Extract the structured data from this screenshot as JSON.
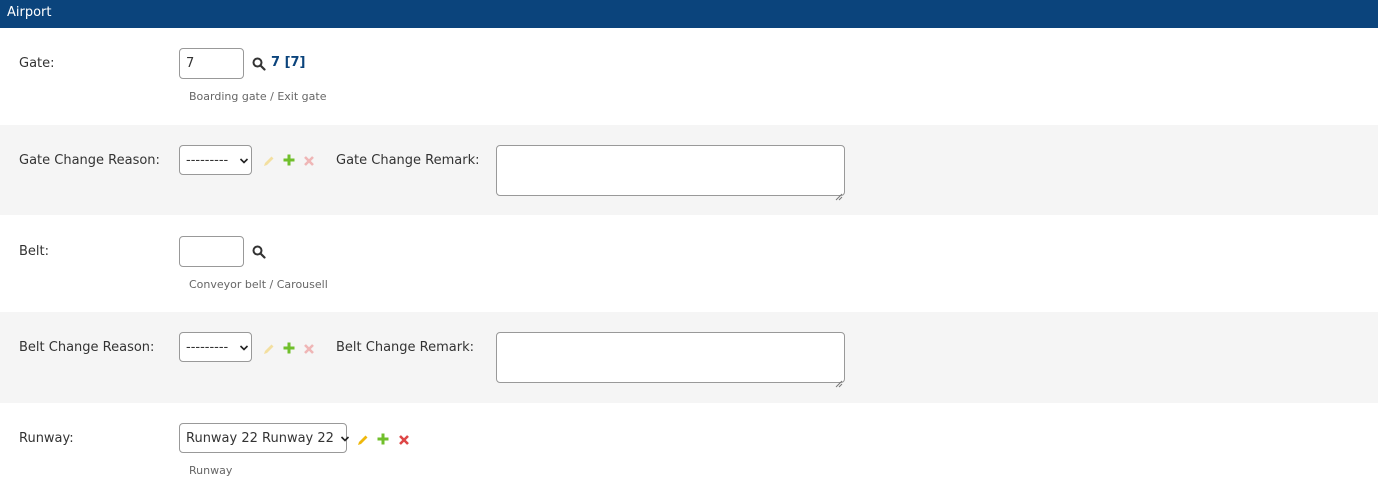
{
  "fieldset": {
    "title": "Airport"
  },
  "gate": {
    "label": "Gate:",
    "value": "7",
    "lookup_text": "7 [7]",
    "help": "Boarding gate / Exit gate",
    "icon": "search-icon"
  },
  "gate_change": {
    "reason_label": "Gate Change Reason:",
    "reason_value": "---------",
    "remark_label": "Gate Change Remark:",
    "remark_value": "",
    "icons": [
      "pencil-icon",
      "plus-icon",
      "delete-icon"
    ]
  },
  "belt": {
    "label": "Belt:",
    "value": "",
    "help": "Conveyor belt / Carousell",
    "icon": "search-icon"
  },
  "belt_change": {
    "reason_label": "Belt Change Reason:",
    "reason_value": "---------",
    "remark_label": "Belt Change Remark:",
    "remark_value": "",
    "icons": [
      "pencil-icon",
      "plus-icon",
      "delete-icon"
    ]
  },
  "runway": {
    "label": "Runway:",
    "value": "Runway 22 Runway 22",
    "help": "Runway",
    "icons": [
      "pencil-icon",
      "plus-icon",
      "delete-icon"
    ]
  },
  "colors": {
    "header": "#0b447c",
    "alt_row": "#f5f5f5",
    "link": "#0b447c",
    "edit_active": "#efb80b",
    "add": "#70bf2b",
    "delete_active": "#dd4646"
  }
}
